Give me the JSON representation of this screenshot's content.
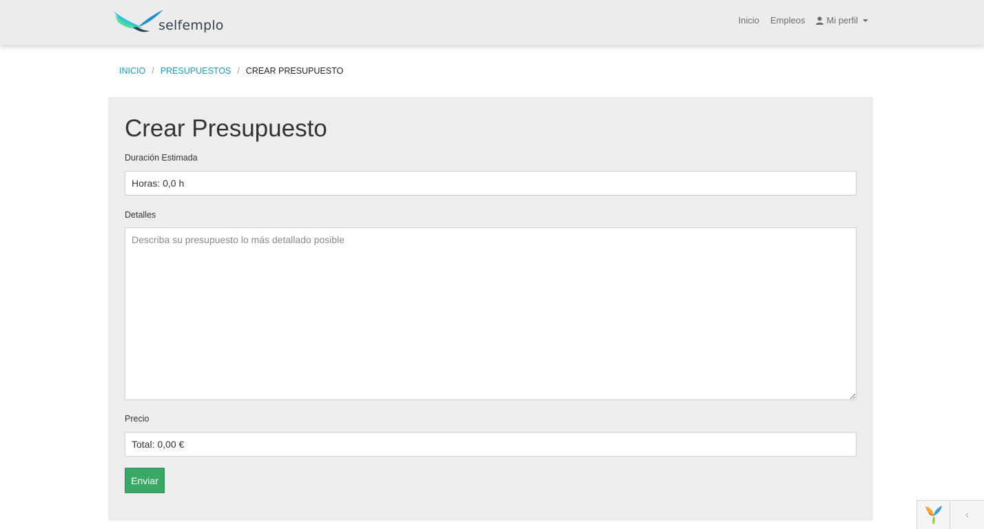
{
  "brand": {
    "name": "selfemplo",
    "accent": "#1e9ab0"
  },
  "nav": {
    "items": [
      {
        "label": "Inicio"
      },
      {
        "label": "Empleos"
      }
    ],
    "profile": {
      "label": "Mi perfil",
      "icon": "user-icon"
    }
  },
  "breadcrumb": {
    "items": [
      {
        "label": "Inicio"
      },
      {
        "label": "Presupuestos"
      }
    ],
    "current": "Crear Presupuesto"
  },
  "form": {
    "title": "Crear Presupuesto",
    "duration": {
      "label": "Duración Estimada",
      "value": "Horas: 0,0 h"
    },
    "details": {
      "label": "Detalles",
      "placeholder": "Describa su presupuesto lo más detallado posible"
    },
    "price": {
      "label": "Precio",
      "value": "Total: 0,00 €"
    },
    "submit_label": "Enviar",
    "submit_color": "#3aa865"
  },
  "debug": {
    "logo": "yii-logo-icon",
    "toggle": "chevron-left-icon"
  }
}
